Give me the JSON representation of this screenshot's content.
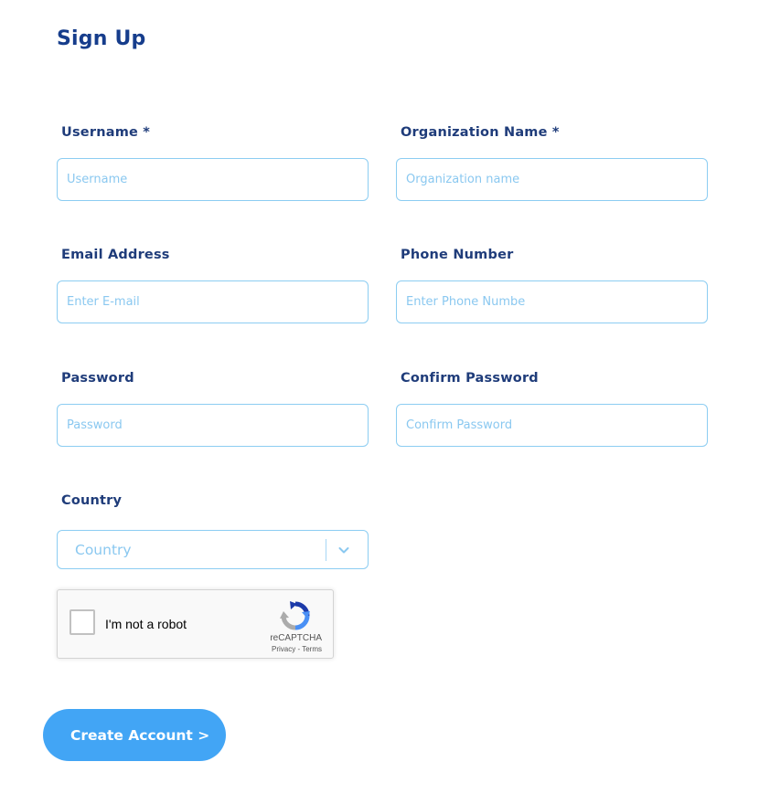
{
  "page": {
    "title": "Sign Up"
  },
  "fields": {
    "username": {
      "label": "Username *",
      "placeholder": "Username",
      "value": ""
    },
    "organization": {
      "label": "Organization Name *",
      "placeholder": "Organization name",
      "value": ""
    },
    "email": {
      "label": "Email Address",
      "placeholder": "Enter E-mail",
      "value": ""
    },
    "phone": {
      "label": "Phone Number",
      "placeholder": "Enter Phone Numbe",
      "value": ""
    },
    "password": {
      "label": "Password",
      "placeholder": "Password",
      "value": ""
    },
    "confirm_password": {
      "label": "Confirm Password",
      "placeholder": "Confirm Password",
      "value": ""
    },
    "country": {
      "label": "Country",
      "selected": "Country"
    }
  },
  "recaptcha": {
    "label": "I'm not a robot",
    "brand": "reCAPTCHA",
    "privacy": "Privacy",
    "separator": " - ",
    "terms": "Terms",
    "checked": false
  },
  "actions": {
    "create_account": "Create Account >"
  },
  "colors": {
    "title": "#163d8c",
    "label": "#1f3c7a",
    "input_border": "#8ccdf2",
    "placeholder": "#8ac8f0",
    "button": "#42a5f5"
  },
  "icons": {
    "country_dropdown": "chevron-down-icon",
    "recaptcha_logo": "recaptcha-logo-icon"
  }
}
